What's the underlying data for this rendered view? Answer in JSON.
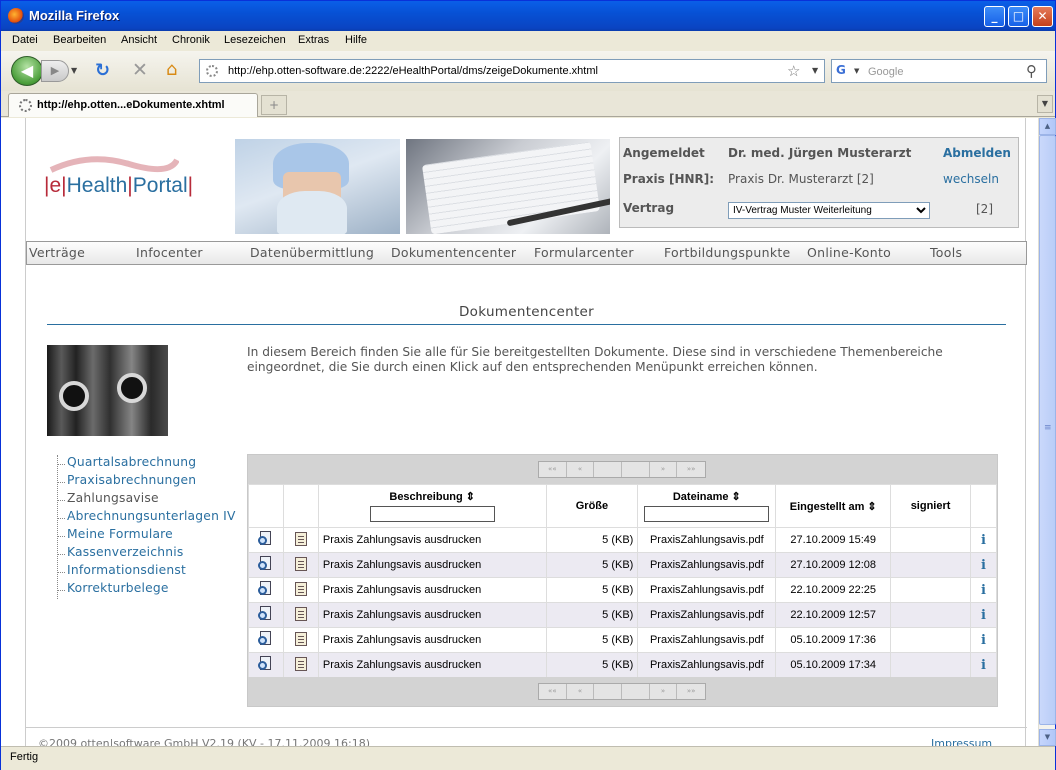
{
  "window": {
    "title": "Mozilla Firefox"
  },
  "menubar": {
    "items": [
      "Datei",
      "Bearbeiten",
      "Ansicht",
      "Chronik",
      "Lesezeichen",
      "Extras",
      "Hilfe"
    ]
  },
  "navbar": {
    "url": "http://ehp.otten-software.de:2222/eHealthPortal/dms/zeigeDokumente.xhtml",
    "search_placeholder": "Google"
  },
  "tabs": [
    {
      "label": "http://ehp.otten...eDokumente.xhtml"
    }
  ],
  "status": "Fertig",
  "header": {
    "logo": {
      "p1": "|e|",
      "p2": "Health",
      "p3": "|",
      "p4": "Portal",
      "p5": "|"
    },
    "login": {
      "angemeldet_label": "Angemeldet",
      "angemeldet_value": "Dr. med. Jürgen Musterarzt",
      "abmelden": "Abmelden",
      "praxis_label": "Praxis [HNR]:",
      "praxis_value": "Praxis Dr. Musterarzt [2]",
      "wechseln": "wechseln",
      "vertrag_label": "Vertrag",
      "vertrag_selected": "IV-Vertrag Muster Weiterleitung",
      "vertrag_id": "[2]"
    }
  },
  "topnav": [
    "Verträge",
    "Infocenter",
    "Datenübermittlung",
    "Dokumentencenter",
    "Formularcenter",
    "Fortbildungspunkte",
    "Online-Konto",
    "Tools"
  ],
  "main": {
    "title": "Dokumentencenter",
    "intro": "In diesem Bereich finden Sie alle für Sie bereitgestellten Dokumente. Diese sind in verschiedene Themenbereiche eingeordnet, die Sie durch einen Klick auf den entsprechenden Menüpunkt erreichen können."
  },
  "leftmenu": {
    "items": [
      "Quartalsabrechnung",
      "Praxisabrechnungen",
      "Zahlungsavise",
      "Abrechnungsunterlagen IV",
      "Meine Formulare",
      "Kassenverzeichnis",
      "Informationsdienst",
      "Korrekturbelege"
    ],
    "current": "Zahlungsavise"
  },
  "table": {
    "pager": [
      "««",
      "«",
      "",
      "",
      "»",
      "»»"
    ],
    "headers": {
      "beschreibung": "Beschreibung ⇕",
      "groesse": "Größe",
      "dateiname": "Dateiname ⇕",
      "eingestellt": "Eingestellt am ⇕",
      "signiert": "signiert"
    },
    "rows": [
      {
        "beschreibung": "Praxis Zahlungsavis ausdrucken",
        "groesse": "5 (KB)",
        "dateiname": "PraxisZahlungsavis.pdf",
        "eingestellt": "27.10.2009 15:49",
        "signiert": "",
        "info": "i"
      },
      {
        "beschreibung": "Praxis Zahlungsavis ausdrucken",
        "groesse": "5 (KB)",
        "dateiname": "PraxisZahlungsavis.pdf",
        "eingestellt": "27.10.2009 12:08",
        "signiert": "",
        "info": "i"
      },
      {
        "beschreibung": "Praxis Zahlungsavis ausdrucken",
        "groesse": "5 (KB)",
        "dateiname": "PraxisZahlungsavis.pdf",
        "eingestellt": "22.10.2009 22:25",
        "signiert": "",
        "info": "i"
      },
      {
        "beschreibung": "Praxis Zahlungsavis ausdrucken",
        "groesse": "5 (KB)",
        "dateiname": "PraxisZahlungsavis.pdf",
        "eingestellt": "22.10.2009 12:57",
        "signiert": "",
        "info": "i"
      },
      {
        "beschreibung": "Praxis Zahlungsavis ausdrucken",
        "groesse": "5 (KB)",
        "dateiname": "PraxisZahlungsavis.pdf",
        "eingestellt": "05.10.2009 17:36",
        "signiert": "",
        "info": "i"
      },
      {
        "beschreibung": "Praxis Zahlungsavis ausdrucken",
        "groesse": "5 (KB)",
        "dateiname": "PraxisZahlungsavis.pdf",
        "eingestellt": "05.10.2009 17:34",
        "signiert": "",
        "info": "i"
      }
    ]
  },
  "footer": {
    "copyright": "©2009 otten|software GmbH V2.19 (KV - 17.11.2009 16:18)",
    "impressum": "Impressum"
  },
  "colors": {
    "link_blue": "#2a6fa0",
    "titlebar_blue": "#0751d5",
    "logo_red": "#b72b3a",
    "row_alt": "#eceaf2"
  },
  "icons": [
    "firefox-icon",
    "back-arrow-icon",
    "forward-arrow-icon",
    "reload-icon",
    "stop-icon",
    "home-icon",
    "bookmark-star-icon",
    "google-icon",
    "search-magnifier-icon",
    "view-document-icon",
    "document-list-icon",
    "info-icon"
  ]
}
